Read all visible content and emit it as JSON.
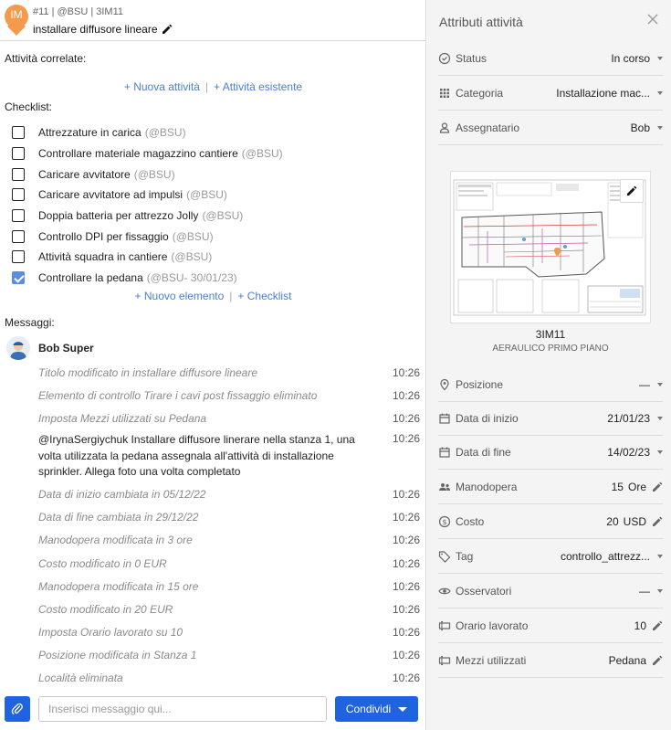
{
  "header": {
    "pin_label": "IM",
    "meta": "#11 | @BSU | 3IM11",
    "title": "installare diffusore lineare"
  },
  "related": {
    "label": "Attività correlate:",
    "new_link": "+ Nuova attività",
    "existing_link": "+ Attività esistente"
  },
  "checklist": {
    "label": "Checklist:",
    "items": [
      {
        "label": "Attrezzature in carica",
        "meta": "(@BSU)",
        "checked": false
      },
      {
        "label": "Controllare materiale magazzino cantiere",
        "meta": "(@BSU)",
        "checked": false
      },
      {
        "label": "Caricare avvitatore",
        "meta": "(@BSU)",
        "checked": false
      },
      {
        "label": "Caricare avvitatore ad impulsi",
        "meta": "(@BSU)",
        "checked": false
      },
      {
        "label": "Doppia batteria per attrezzo Jolly",
        "meta": "(@BSU)",
        "checked": false
      },
      {
        "label": "Controllo DPI per fissaggio",
        "meta": "(@BSU)",
        "checked": false
      },
      {
        "label": "Attività squadra in cantiere",
        "meta": "(@BSU)",
        "checked": false
      },
      {
        "label": "Controllare la pedana",
        "meta": "(@BSU- 30/01/23)",
        "checked": true
      }
    ],
    "new_item_link": "+ Nuovo elemento",
    "new_checklist_link": "+ Checklist"
  },
  "messages": {
    "label": "Messaggi:",
    "author": "Bob Super",
    "items": [
      {
        "text": "Titolo modificato in installare diffusore lineare",
        "time": "10:26",
        "type": "sys"
      },
      {
        "text": "Elemento di controllo Tirare i cavi post fissaggio eliminato",
        "time": "10:26",
        "type": "sys"
      },
      {
        "text": "Imposta Mezzi utilizzati su Pedana",
        "time": "10:26",
        "type": "sys"
      },
      {
        "text": "@IrynaSergiychuk  Installare diffusore linerare nella stanza 1, una volta utilizzata la pedana assegnala all'attività di installazione sprinkler. Allega foto una volta completato",
        "time": "10:26",
        "type": "usr"
      },
      {
        "text": "Data di inizio cambiata in 05/12/22",
        "time": "10:26",
        "type": "sys"
      },
      {
        "text": "Data di fine cambiata in 29/12/22",
        "time": "10:26",
        "type": "sys"
      },
      {
        "text": "Manodopera modificata in 3 ore",
        "time": "10:26",
        "type": "sys"
      },
      {
        "text": "Costo modificato in 0 EUR",
        "time": "10:26",
        "type": "sys"
      },
      {
        "text": "Manodopera modificata in 15 ore",
        "time": "10:26",
        "type": "sys"
      },
      {
        "text": "Costo modificato in 20 EUR",
        "time": "10:26",
        "type": "sys"
      },
      {
        "text": "Imposta Orario lavorato su 10",
        "time": "10:26",
        "type": "sys"
      },
      {
        "text": "Posizione modificata in Stanza 1",
        "time": "10:26",
        "type": "sys"
      },
      {
        "text": "Località eliminata",
        "time": "10:26",
        "type": "sys"
      }
    ]
  },
  "composer": {
    "placeholder": "Inserisci messaggio qui...",
    "share_label": "Condividi"
  },
  "attributes": {
    "title": "Attributi attività",
    "status": {
      "label": "Status",
      "value": "In corso"
    },
    "category": {
      "label": "Categoria",
      "value": "Installazione mac..."
    },
    "assignee": {
      "label": "Assegnatario",
      "value": "Bob"
    },
    "plan": {
      "name": "3IM11",
      "subtitle": "AERAULICO PRIMO PIANO"
    },
    "position": {
      "label": "Posizione",
      "value": "—"
    },
    "start_date": {
      "label": "Data di inizio",
      "value": "21/01/23"
    },
    "end_date": {
      "label": "Data di fine",
      "value": "14/02/23"
    },
    "labor": {
      "label": "Manodopera",
      "value": "15",
      "unit": "Ore"
    },
    "cost": {
      "label": "Costo",
      "value": "20",
      "unit": "USD"
    },
    "tag": {
      "label": "Tag",
      "value": "controllo_attrezz..."
    },
    "observers": {
      "label": "Osservatori",
      "value": "—"
    },
    "hours_worked": {
      "label": "Orario lavorato",
      "value": "10"
    },
    "tools_used": {
      "label": "Mezzi utilizzati",
      "value": "Pedana"
    }
  },
  "colors": {
    "accent": "#1f63e0",
    "link": "#4a7fd6",
    "pin": "#f39a4c"
  }
}
